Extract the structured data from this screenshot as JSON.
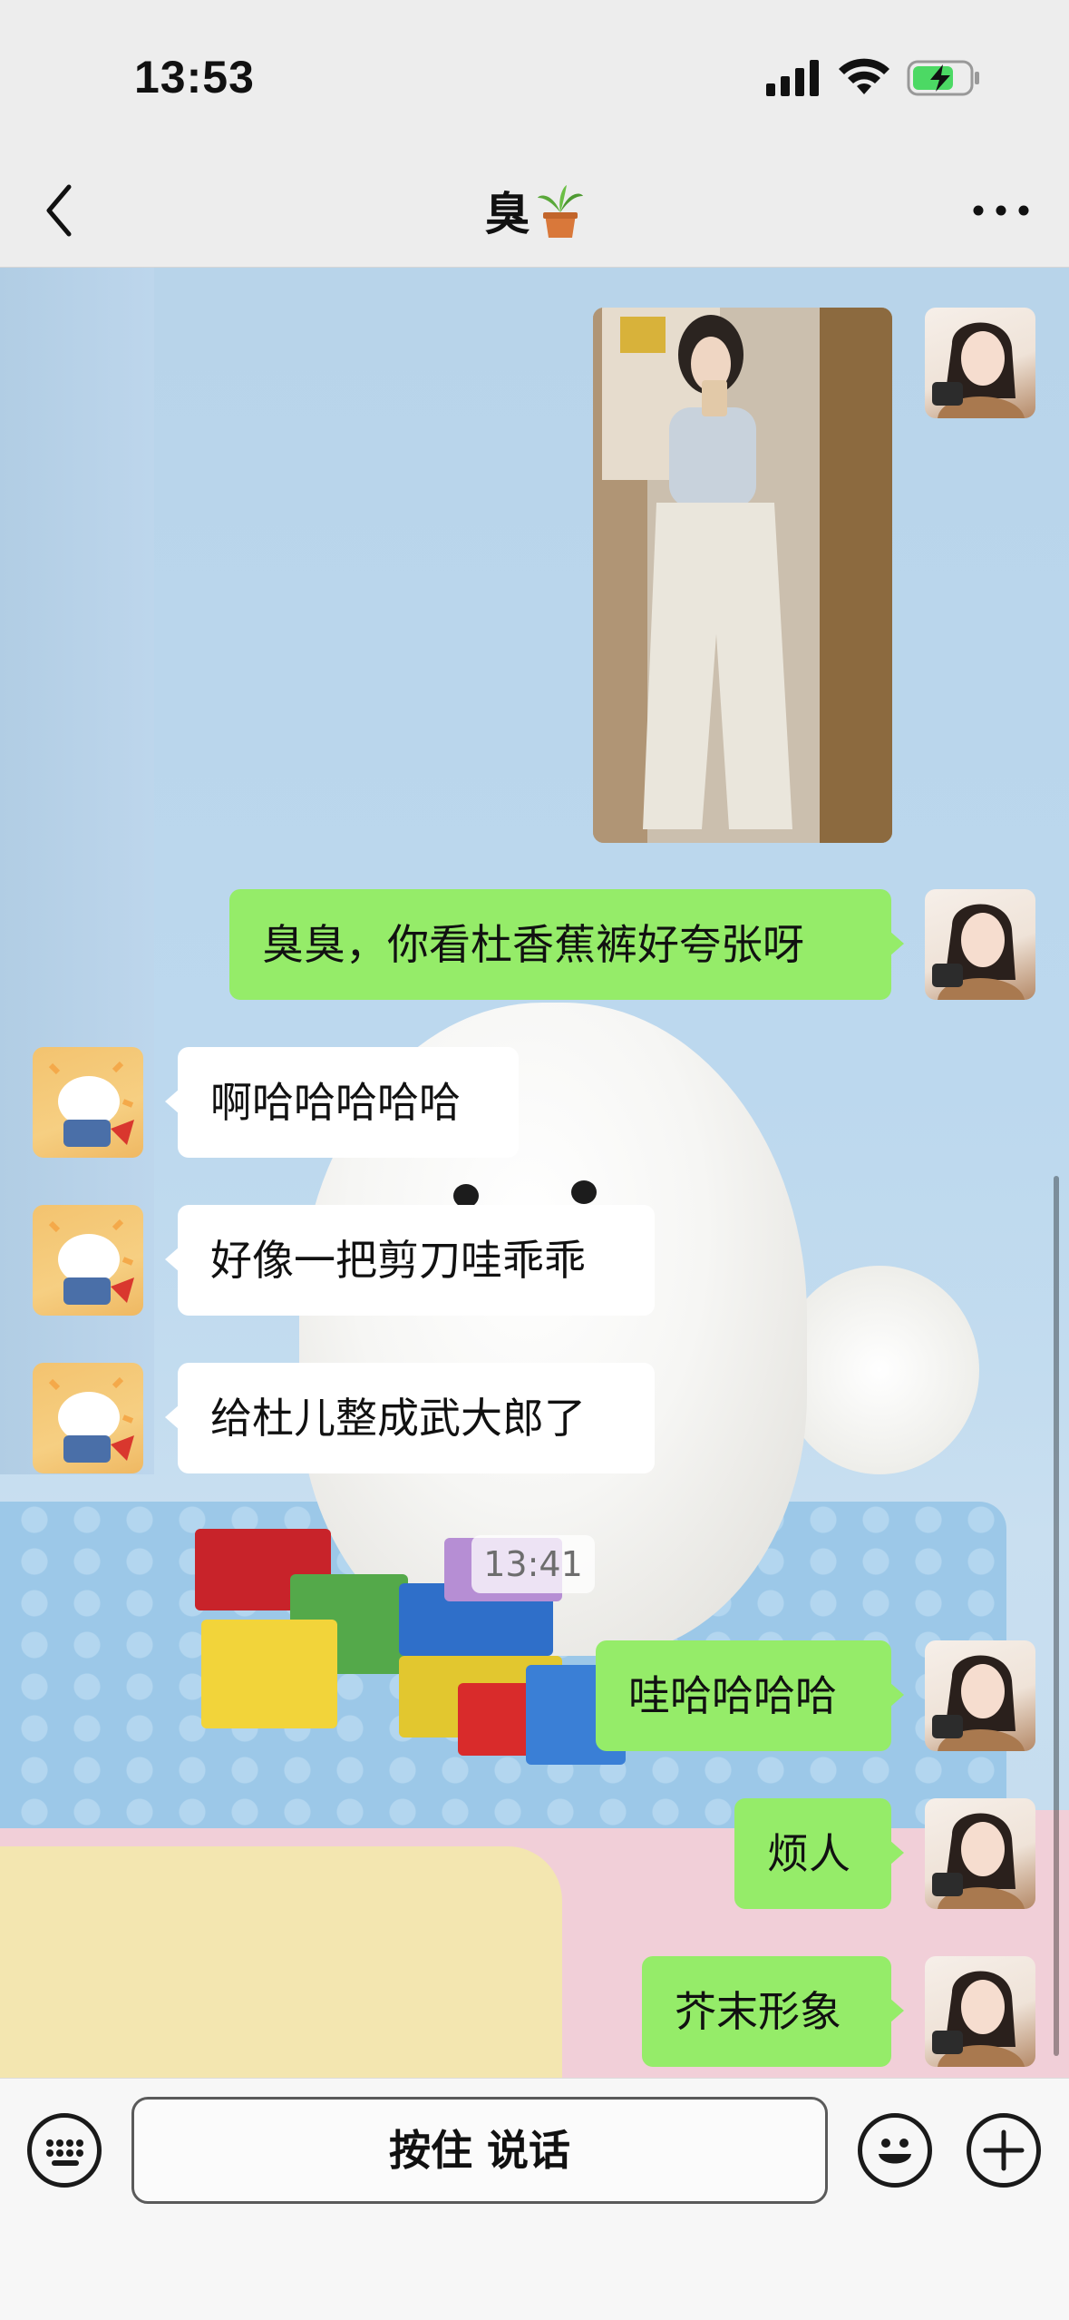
{
  "status_bar": {
    "time": "13:53",
    "signal_icon": "cellular-signal-icon",
    "wifi_icon": "wifi-icon",
    "battery_icon": "battery-charging-icon",
    "battery_color": "#4cd964"
  },
  "header": {
    "title": "臭",
    "title_emoji": "🪴",
    "back_icon": "chevron-left-icon",
    "more_icon": "more-dots-icon"
  },
  "messages": [
    {
      "sender": "me",
      "type": "image"
    },
    {
      "sender": "me",
      "type": "text",
      "text": "臭臭，你看杜香蕉裤好夸张呀"
    },
    {
      "sender": "them",
      "type": "text",
      "text": "啊哈哈哈哈哈"
    },
    {
      "sender": "them",
      "type": "text",
      "text": "好像一把剪刀哇乖乖"
    },
    {
      "sender": "them",
      "type": "text",
      "text": "给杜儿整成武大郎了"
    },
    {
      "type": "timestamp",
      "text": "13:41"
    },
    {
      "sender": "me",
      "type": "text",
      "text": "哇哈哈哈哈"
    },
    {
      "sender": "me",
      "type": "text",
      "text": "烦人"
    },
    {
      "sender": "me",
      "type": "text",
      "text": "芥末形象"
    }
  ],
  "input_bar": {
    "keyboard_icon": "keyboard-icon",
    "hold_to_talk_label": "按住 说话",
    "emoji_icon": "emoji-smile-icon",
    "plus_icon": "plus-icon"
  },
  "colors": {
    "my_bubble": "#95ec69",
    "their_bubble": "#ffffff",
    "bar_bg": "#ededed"
  }
}
